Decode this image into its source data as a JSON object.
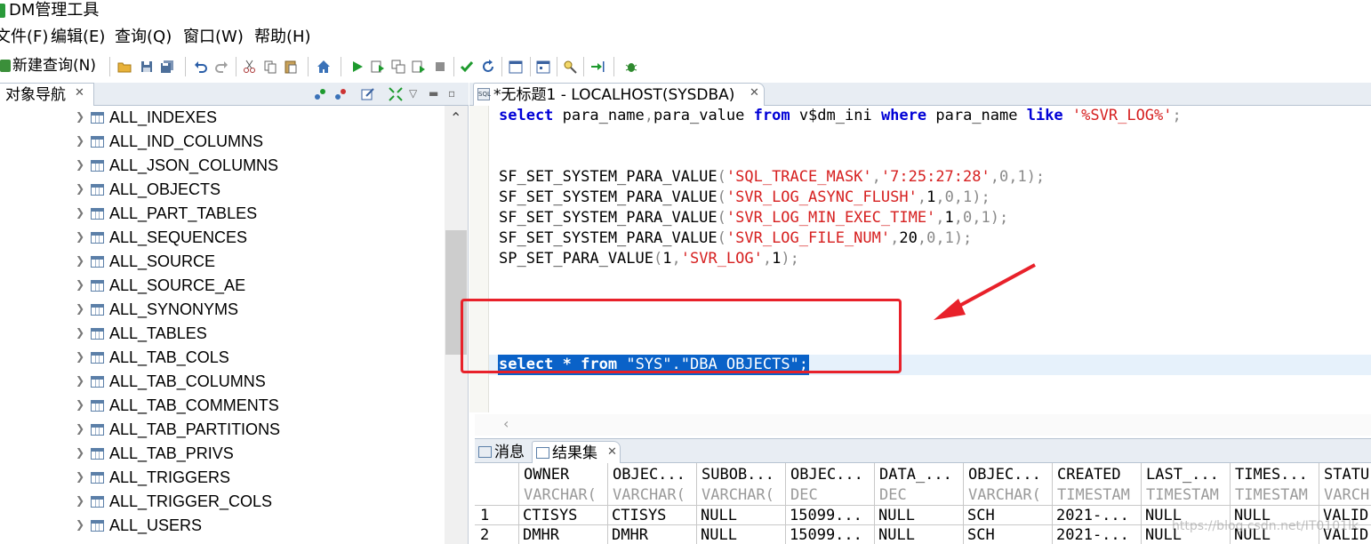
{
  "app": {
    "title": "DM管理工具"
  },
  "menu": [
    "文件(F)",
    "编辑(E)",
    "查询(Q)",
    "窗口(W)",
    "帮助(H)"
  ],
  "toolbar": {
    "new_query_label": "新建查询(N)"
  },
  "navigator": {
    "tab_label": "对象导航",
    "items": [
      "ALL_INDEXES",
      "ALL_IND_COLUMNS",
      "ALL_JSON_COLUMNS",
      "ALL_OBJECTS",
      "ALL_PART_TABLES",
      "ALL_SEQUENCES",
      "ALL_SOURCE",
      "ALL_SOURCE_AE",
      "ALL_SYNONYMS",
      "ALL_TABLES",
      "ALL_TAB_COLS",
      "ALL_TAB_COLUMNS",
      "ALL_TAB_COMMENTS",
      "ALL_TAB_PARTITIONS",
      "ALL_TAB_PRIVS",
      "ALL_TRIGGERS",
      "ALL_TRIGGER_COLS",
      "ALL_USERS"
    ]
  },
  "editor": {
    "tab_label": "*无标题1 - LOCALHOST(SYSDBA)",
    "sql_icon_text": "SQL",
    "line1": {
      "kw_select": "select",
      "cols": " para_name",
      "comma": ",",
      "col2": "para_value ",
      "kw_from": "from",
      "tbl": " v$dm_ini ",
      "kw_where": "where",
      "col3": " para_name ",
      "kw_like": "like",
      "sp": " ",
      "str": "'%SVR_LOG%'",
      "semi": ";"
    },
    "calls": [
      {
        "fn": "SF_SET_SYSTEM_PARA_VALUE",
        "arg1": "'SQL_TRACE_MASK'",
        "rest_pre": ",",
        "arg2": "'7:25:27:28'",
        "rest": ",0,1",
        "end": ");"
      },
      {
        "fn": "SF_SET_SYSTEM_PARA_VALUE",
        "arg1": "'SVR_LOG_ASYNC_FLUSH'",
        "rest_pre": ",",
        "arg2": "1",
        "rest": ",0,1",
        "end": ");"
      },
      {
        "fn": "SF_SET_SYSTEM_PARA_VALUE",
        "arg1": "'SVR_LOG_MIN_EXEC_TIME'",
        "rest_pre": ",",
        "arg2": "1",
        "rest": ",0,1",
        "end": ");"
      },
      {
        "fn": "SF_SET_SYSTEM_PARA_VALUE",
        "arg1": "'SVR_LOG_FILE_NUM'",
        "rest_pre": ",",
        "arg2": "20",
        "rest": ",0,1",
        "end": ");"
      }
    ],
    "sp_call": {
      "fn": "SP_SET_PARA_VALUE",
      "a1": "1",
      "a2": "'SVR_LOG'",
      "a3": "1",
      "end": ");"
    },
    "selected": {
      "kw_select": "select",
      "star": " * ",
      "kw_from": "from",
      "rest": " \"SYS\".\"DBA_OBJECTS\";"
    }
  },
  "results": {
    "tab_messages": "消息",
    "tab_results": "结果集",
    "columns": [
      {
        "name": "OWNER",
        "type": "VARCHAR("
      },
      {
        "name": "OBJEC...",
        "type": "VARCHAR("
      },
      {
        "name": "SUBOB...",
        "type": "VARCHAR("
      },
      {
        "name": "OBJEC...",
        "type": "DEC"
      },
      {
        "name": "DATA_...",
        "type": "DEC"
      },
      {
        "name": "OBJEC...",
        "type": "VARCHAR("
      },
      {
        "name": "CREATED",
        "type": "TIMESTAM"
      },
      {
        "name": "LAST_...",
        "type": "TIMESTAM"
      },
      {
        "name": "TIMES...",
        "type": "TIMESTAM"
      },
      {
        "name": "STATU",
        "type": "VARCH"
      }
    ],
    "rows": [
      {
        "num": "1",
        "cells": [
          "CTISYS",
          "CTISYS",
          "NULL",
          "15099...",
          "NULL",
          "SCH",
          "2021-...",
          "NULL",
          "NULL",
          "VALID"
        ]
      },
      {
        "num": "2",
        "cells": [
          "DMHR",
          "DMHR",
          "NULL",
          "15099...",
          "NULL",
          "SCH",
          "2021-...",
          "NULL",
          "NULL",
          "VALID"
        ]
      }
    ]
  },
  "watermark": "https://blog.csdn.net/IT0101lk",
  "colors": {
    "keyword": "#0000d6",
    "string": "#d62020",
    "selection": "#0a62c8",
    "annotation": "#e8212a"
  }
}
